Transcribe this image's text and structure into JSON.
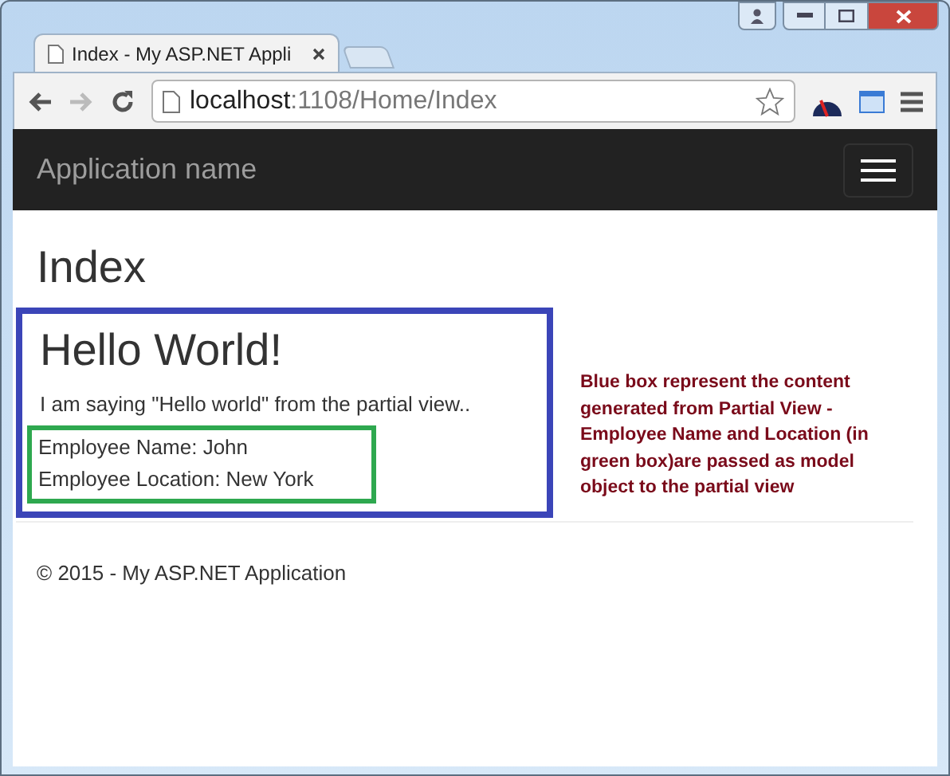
{
  "browser": {
    "tab": {
      "title": "Index - My ASP.NET Appli",
      "selected": true
    },
    "address": {
      "host": "localhost",
      "path": ":1108/Home/Index"
    }
  },
  "navbar": {
    "brand": "Application name"
  },
  "page": {
    "heading": "Index",
    "partial_view": {
      "heading": "Hello World!",
      "text": "I am saying \"Hello world\" from the partial view..",
      "employee": [
        "Employee Name: John",
        "Employee Location: New York"
      ]
    },
    "annotation": "Blue box represent the content generated from Partial View - Employee Name and Location (in green box)are passed as model object to the partial view",
    "footer": "© 2015 - My ASP.NET Application"
  }
}
